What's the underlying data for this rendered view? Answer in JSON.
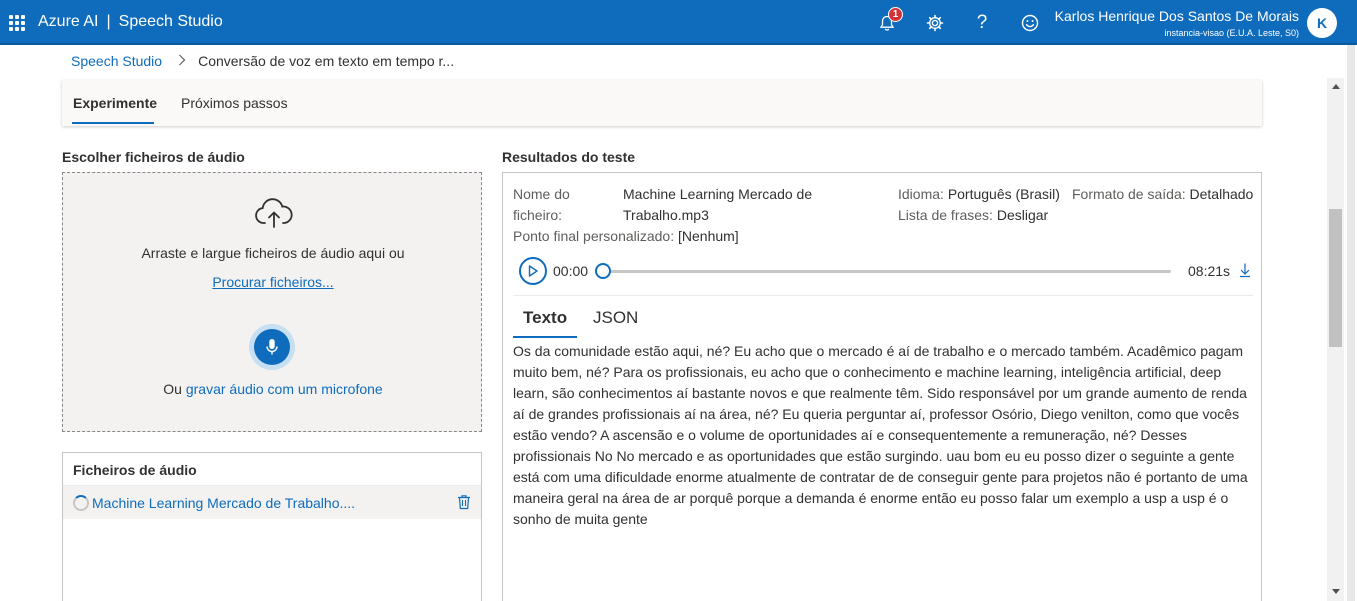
{
  "header": {
    "brand": "Azure AI",
    "separator": "|",
    "product": "Speech Studio",
    "notification_count": "1",
    "user_name": "Karlos Henrique Dos Santos De Morais",
    "user_resource": "instancia-visao (E.U.A. Leste, S0)",
    "avatar_initial": "K",
    "icons": [
      "waffle-icon",
      "bell-icon",
      "gear-icon",
      "help-icon",
      "smiley-icon"
    ]
  },
  "breadcrumb": {
    "root": "Speech Studio",
    "current": "Conversão de voz em texto em tempo r..."
  },
  "tabs": [
    {
      "label": "Experimente",
      "active": true
    },
    {
      "label": "Próximos passos",
      "active": false
    }
  ],
  "upload": {
    "title": "Escolher ficheiros de áudio",
    "drag_text": "Arraste e largue ficheiros de áudio aqui ou",
    "browse_link": "Procurar ficheiros...",
    "record_prefix": "Ou",
    "record_link": "gravar áudio com um microfone"
  },
  "files": {
    "title": "Ficheiros de áudio",
    "items": [
      {
        "name": "Machine Learning Mercado de Trabalho...."
      }
    ]
  },
  "results": {
    "title": "Resultados do teste",
    "file_name_label_1": "Nome do",
    "file_name_label_2": "ficheiro:",
    "file_name_value_1": "Machine Learning Mercado de",
    "file_name_value_2": "Trabalho.mp3",
    "language_label": "Idioma:",
    "language_value": "Português (Brasil)",
    "output_format_label": "Formato de saída:",
    "output_format_value": "Detalhado",
    "phrase_list_label": "Lista de frases:",
    "phrase_list_value": "Desligar",
    "endpoint_label": "Ponto final personalizado:",
    "endpoint_value": "[Nenhum]",
    "player": {
      "current_time": "00:00",
      "duration": "08:21s",
      "progress": 0
    },
    "result_tabs": [
      {
        "label": "Texto",
        "active": true
      },
      {
        "label": "JSON",
        "active": false
      }
    ],
    "transcript": "Os da comunidade estão aqui, né? Eu acho que o mercado é aí de trabalho e o mercado também. Acadêmico pagam muito bem, né? Para os profissionais, eu acho que o conhecimento e machine learning, inteligência artificial, deep learn, são conhecimentos aí bastante novos e que realmente têm. Sido responsável por um grande aumento de renda aí de grandes profissionais aí na área, né? Eu queria perguntar aí, professor Osório, Diego venilton, como que vocês estão vendo? A ascensão e o volume de oportunidades aí e consequentemente a remuneração, né? Desses profissionais No No mercado e as oportunidades que estão surgindo. uau bom eu eu posso dizer o seguinte a gente está com uma dificuldade enorme atualmente de contratar de de conseguir gente para projetos não é portanto de uma maneira geral na área de ar porquê porque a demanda é enorme então eu posso falar um exemplo a usp a usp é o sonho de muita gente"
  },
  "colors": {
    "accent": "#0f6cbd",
    "badge": "#d13438"
  }
}
